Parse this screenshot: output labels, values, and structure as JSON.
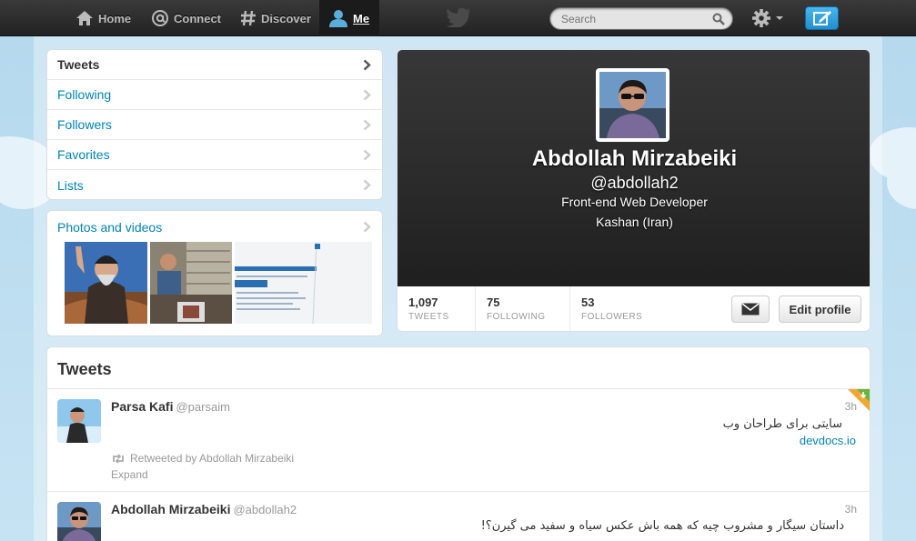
{
  "nav": {
    "home": "Home",
    "connect": "Connect",
    "discover": "Discover",
    "me": "Me",
    "search_placeholder": "Search"
  },
  "dashboard": {
    "items": [
      {
        "label": "Tweets"
      },
      {
        "label": "Following"
      },
      {
        "label": "Followers"
      },
      {
        "label": "Favorites"
      },
      {
        "label": "Lists"
      }
    ],
    "photos_title": "Photos and videos"
  },
  "profile": {
    "name": "Abdollah Mirzabeiki",
    "handle": "@abdollah2",
    "bio": "Front-end Web Developer",
    "location": "Kashan (Iran)",
    "stats": {
      "tweets": {
        "value": "1,097",
        "label": "TWEETS"
      },
      "following": {
        "value": "75",
        "label": "FOLLOWING"
      },
      "followers": {
        "value": "53",
        "label": "FOLLOWERS"
      }
    },
    "edit_label": "Edit profile"
  },
  "stream": {
    "title": "Tweets",
    "tweets": [
      {
        "name": "Parsa Kafi",
        "handle": "@parsaim",
        "time": "3h",
        "text": "سایتی برای طراحان وب",
        "link": "devdocs.io",
        "retweet": "Retweeted by Abdollah Mirzabeiki",
        "expand": "Expand"
      },
      {
        "name": "Abdollah Mirzabeiki",
        "handle": "@abdollah2",
        "time": "3h",
        "text": "داستان سیگار و مشروب چیه که همه باش عکس سیاه و سفید می گیرن؟!"
      }
    ]
  },
  "colors": {
    "link": "#0084b4",
    "topbar": "#2b2b2b",
    "background": "#c0deed",
    "compose": "#1f8fcf"
  }
}
